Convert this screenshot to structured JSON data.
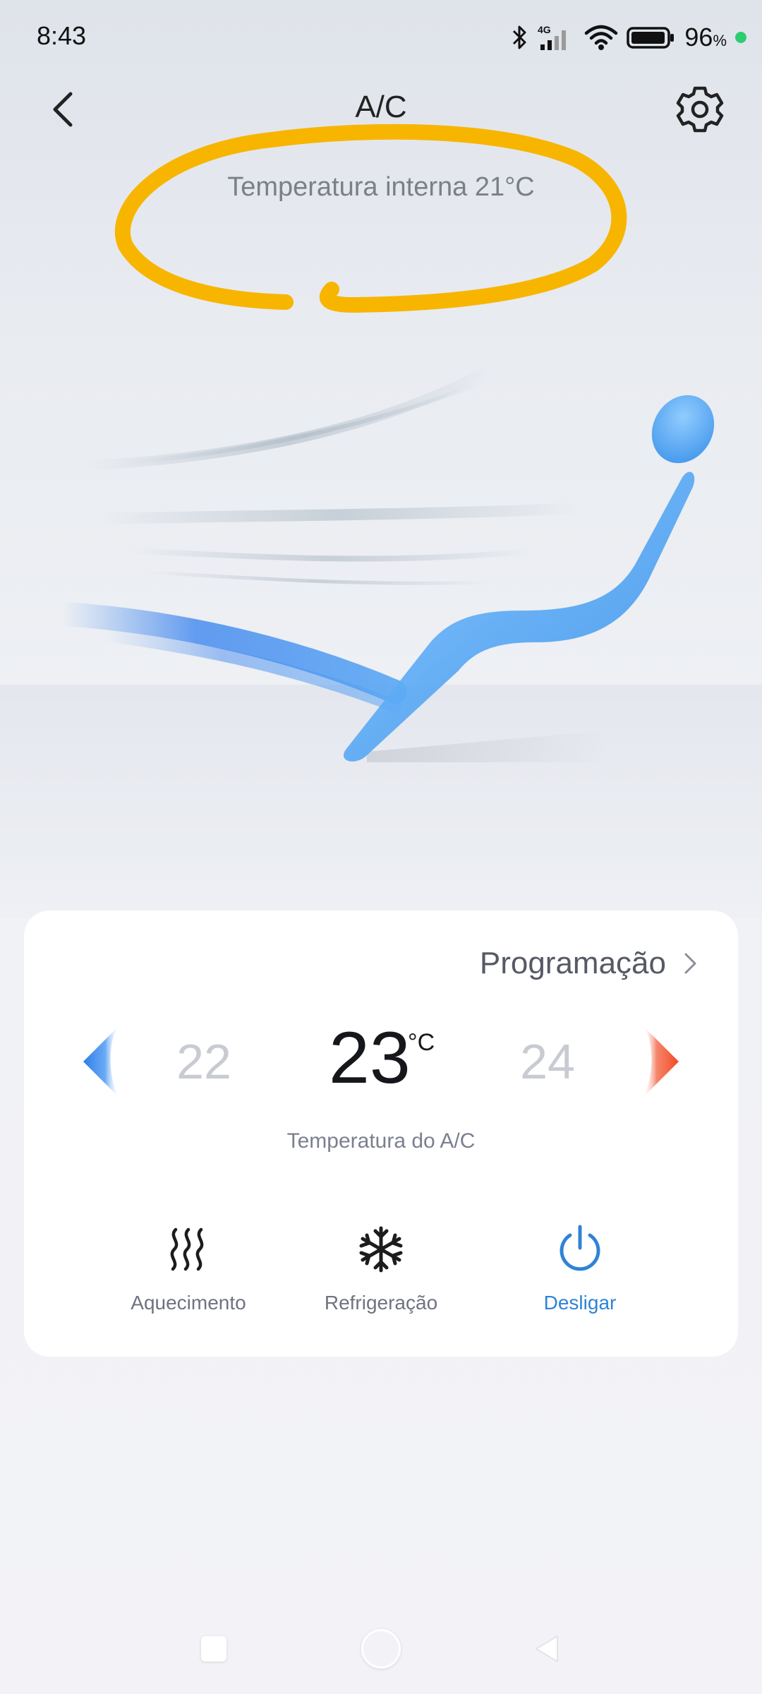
{
  "status_bar": {
    "time": "8:43",
    "network": "4G",
    "battery_level": "96",
    "battery_unit": "%",
    "icons": [
      "bluetooth-icon",
      "signal-icon",
      "wifi-icon",
      "battery-icon"
    ],
    "dot_color": "#2ecc71"
  },
  "header": {
    "title": "A/C",
    "back_icon": "chevron-left-icon",
    "settings_icon": "gear-icon"
  },
  "inner_temperature": "Temperatura interna 21°C",
  "annotation_color": "#f7b500",
  "control_card": {
    "schedule_label": "Programação",
    "temp_prev": "22",
    "temp_current": "23",
    "temp_unit": "°C",
    "temp_next": "24",
    "temp_caption": "Temperatura do A/C",
    "modes": [
      {
        "label": "Aquecimento",
        "icon": "heat-icon",
        "active": false
      },
      {
        "label": "Refrigeração",
        "icon": "snowflake-icon",
        "active": false
      },
      {
        "label": "Desligar",
        "icon": "power-icon",
        "active": true
      }
    ]
  },
  "colors": {
    "accent": "#2f83d6",
    "decrease": "#3a8ff0",
    "increase": "#f0583a"
  },
  "nav_bar": {
    "icons": [
      "recent-apps-icon",
      "home-icon",
      "back-icon"
    ]
  }
}
